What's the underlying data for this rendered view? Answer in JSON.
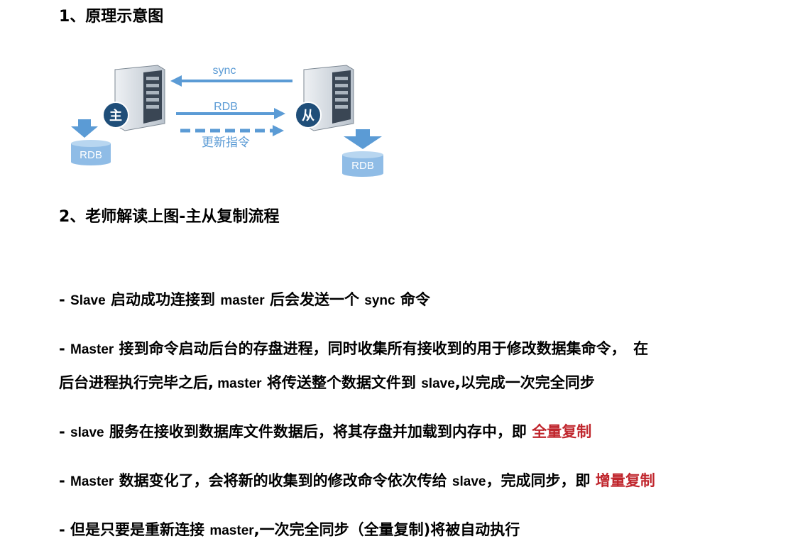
{
  "section1": {
    "heading": "1、原理示意图"
  },
  "diagram": {
    "master_badge": "主",
    "slave_badge": "从",
    "arrow_sync": "sync",
    "arrow_rdb": "RDB",
    "arrow_update": "更新指令",
    "master_db": "RDB",
    "slave_db": "RDB",
    "colors": {
      "arrow": "#5b9bd5",
      "badge": "#1f4e79",
      "db": "#8fbce6"
    }
  },
  "section2": {
    "heading": "2、老师解读上图-主从复制流程"
  },
  "paragraphs": {
    "p1": {
      "prefix": "- ",
      "slave": "Slave",
      "t1": " 启动成功连接到 ",
      "master": "master",
      "t2": " 后会发送一个 ",
      "sync": "sync",
      "t3": " 命令"
    },
    "p2": {
      "prefix": "- ",
      "master": "Master",
      "t1": " 接到命令启动后台的存盘进程，同时收集所有接收到的用于修改数据集命令，　在",
      "line2_t1": "后台进程执行完毕之后,",
      "master2": " master",
      "line2_t2": " 将传送整个数据文件到 ",
      "slave": "slave",
      "line2_t3": ",以完成一次完全同步"
    },
    "p3": {
      "prefix": "- ",
      "slave": "slave",
      "t1": " 服务在接收到数据库文件数据后，将其存盘并加载到内存中，即 ",
      "highlight": "全量复制"
    },
    "p4": {
      "prefix": "- ",
      "master": "Master",
      "t1": " 数据变化了，会将新的收集到的修改命令依次传给 ",
      "slave": "slave",
      "t2": "，完成同步，即 ",
      "highlight": "增量复制"
    },
    "p5": {
      "prefix": "-  ",
      "t1": "但是只要是重新连接 ",
      "master": "master",
      "t2": ",一次完全同步（全量复制)将被自动执行"
    }
  }
}
